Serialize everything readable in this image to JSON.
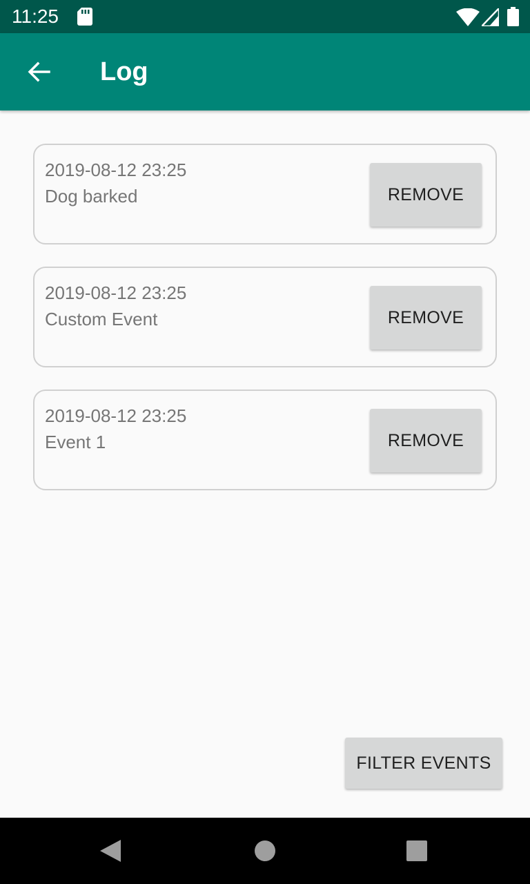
{
  "status_bar": {
    "time": "11:25",
    "icons": [
      "sd-card-icon",
      "wifi-icon",
      "signal-icon",
      "battery-icon"
    ]
  },
  "app_bar": {
    "title": "Log",
    "back_icon": "arrow-back-icon",
    "color": "#008577"
  },
  "events": [
    {
      "timestamp": "2019-08-12 23:25",
      "name": "Dog barked",
      "remove_label": "REMOVE"
    },
    {
      "timestamp": "2019-08-12 23:25",
      "name": "Custom Event",
      "remove_label": "REMOVE"
    },
    {
      "timestamp": "2019-08-12 23:25",
      "name": "Event 1",
      "remove_label": "REMOVE"
    }
  ],
  "filter_button": {
    "label": "FILTER EVENTS"
  },
  "nav_bar": {
    "icons": [
      "nav-back-icon",
      "nav-home-icon",
      "nav-recents-icon"
    ]
  }
}
